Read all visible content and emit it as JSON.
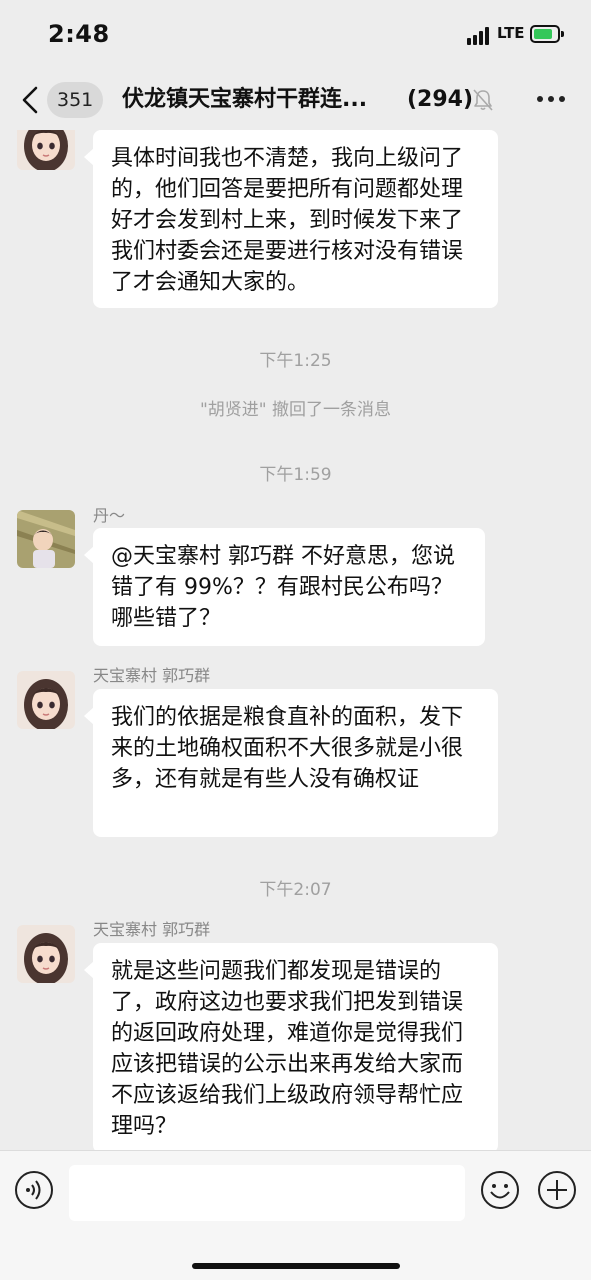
{
  "status": {
    "time": "2:48",
    "network": "LTE",
    "battery_level": 0.8
  },
  "nav": {
    "unread_count": "351",
    "title": "伏龙镇天宝寨村干群连...",
    "member_count": "(294)"
  },
  "messages": [
    {
      "sender": "",
      "text": "具体时间我也不清楚，我向上级问了的，他们回答是要把所有问题都处理好才会发到村上来，到时候发下来了我们村委会还是要进行核对没有错误了才会通知大家的。"
    },
    {
      "timestamp": "下午1:25"
    },
    {
      "system": "\"胡贤进\" 撤回了一条消息"
    },
    {
      "timestamp": "下午1:59"
    },
    {
      "sender": "丹～",
      "text": "@天宝寨村 郭巧群 不好意思，您说错了有 99%？？有跟村民公布吗？哪些错了？"
    },
    {
      "sender": "天宝寨村 郭巧群",
      "text": "我们的依据是粮食直补的面积，发下来的土地确权面积不大很多就是小很多，还有就是有些人没有确权证"
    },
    {
      "timestamp": "下午2:07"
    },
    {
      "sender": "天宝寨村 郭巧群",
      "text": "就是这些问题我们都发现是错误的了，政府这边也要求我们把发到错误的返回政府处理，难道你是觉得我们应该把错误的公示出来再发给大家而不应该返给我们上级政府领导帮忙应理吗？"
    }
  ],
  "input": {
    "placeholder": ""
  },
  "colors": {
    "background": "#ededed",
    "bubble": "#ffffff",
    "timestamp": "#a0a0a0"
  }
}
